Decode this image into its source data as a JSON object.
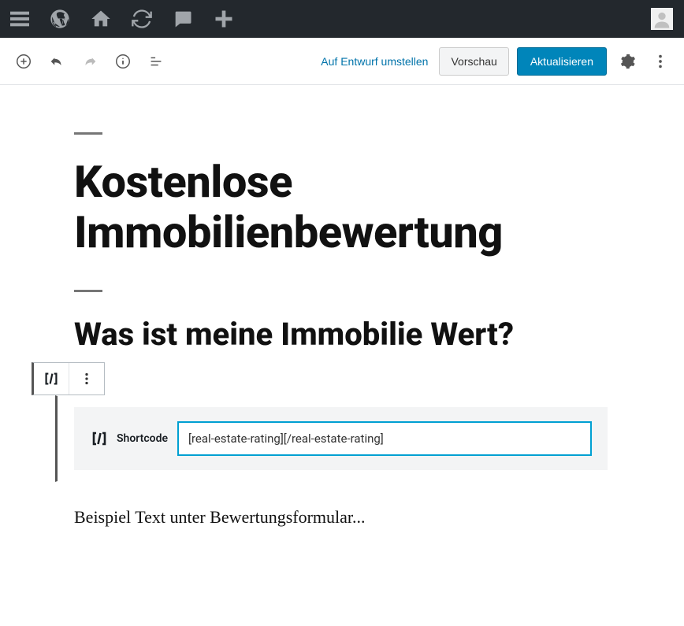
{
  "adminbar": {
    "icons": [
      "menu",
      "wordpress",
      "home",
      "refresh",
      "comment",
      "plus"
    ]
  },
  "toolbar": {
    "switch_to_draft": "Auf Entwurf umstellen",
    "preview_label": "Vorschau",
    "update_label": "Aktualisieren"
  },
  "content": {
    "page_title": "Kostenlose Immobilienbewertung",
    "heading2": "Was ist meine Immobilie Wert?",
    "shortcode_label": "Shortcode",
    "shortcode_value": "[real-estate-rating][/real-estate-rating]",
    "body_text": "Beispiel Text unter Bewertungsformular..."
  }
}
